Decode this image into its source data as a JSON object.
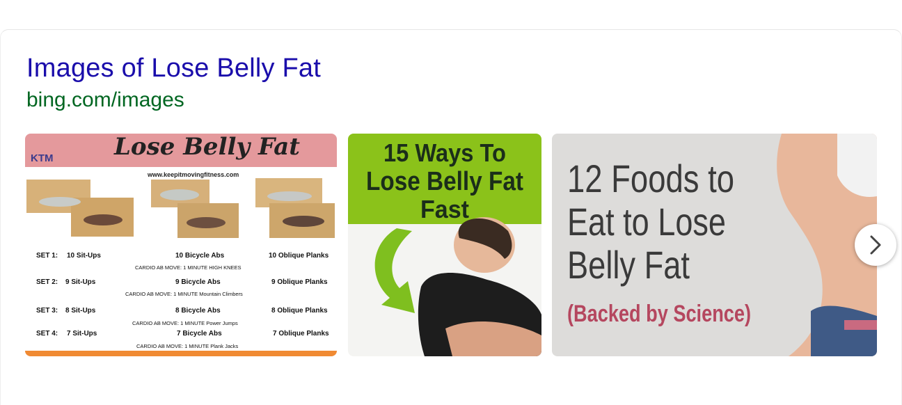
{
  "result": {
    "title": "Images of Lose Belly Fat",
    "source": "bing.com/images"
  },
  "images": [
    {
      "heading": "Lose Belly Fat",
      "logo": "KTM",
      "url": "www.keepitmovingfitness.com",
      "sets": [
        {
          "set": "SET 1:",
          "a": "10 Sit-Ups",
          "b": "10 Bicycle Abs",
          "c": "10 Oblique Planks",
          "cardio": "CARDIO AB MOVE: 1 MINUTE  HIGH KNEES"
        },
        {
          "set": "SET 2:",
          "a": "9 Sit-Ups",
          "b": "9 Bicycle Abs",
          "c": "9 Oblique Planks",
          "cardio": "CARDIO AB MOVE: 1 MINUTE  Mountain Climbers"
        },
        {
          "set": "SET 3:",
          "a": "8 Sit-Ups",
          "b": "8 Bicycle Abs",
          "c": "8 Oblique Planks",
          "cardio": "CARDIO AB MOVE: 1 MINUTE  Power Jumps"
        },
        {
          "set": "SET 4:",
          "a": "7 Sit-Ups",
          "b": "7 Bicycle Abs",
          "c": "7 Oblique Planks",
          "cardio": "CARDIO AB MOVE: 1 MINUTE  Plank Jacks"
        }
      ]
    },
    {
      "line1": "15 Ways To",
      "line2": "Lose Belly Fat",
      "line3": "Fast"
    },
    {
      "line1": "12 Foods to",
      "line2": "Eat to Lose",
      "line3": "Belly Fat",
      "line4": "(Backed by Science)"
    }
  ],
  "icons": {
    "next": "chevron-right-icon"
  }
}
